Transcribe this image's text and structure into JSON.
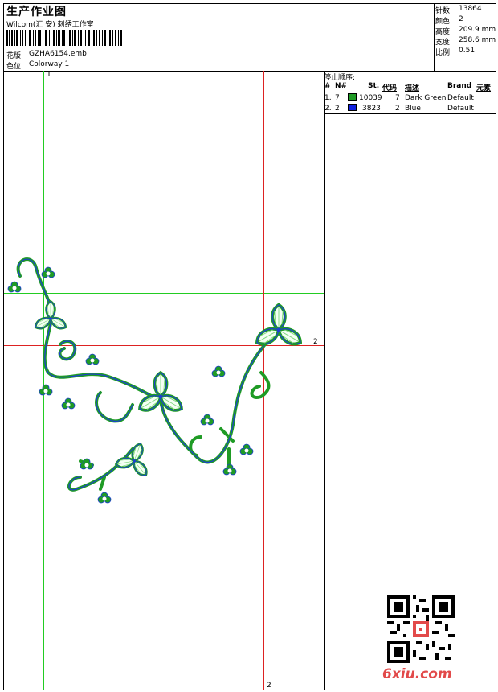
{
  "header": {
    "title": "生产作业图",
    "subtitle": "Wilcom(汇 安) 刺绣工作室",
    "design_label": "花版:",
    "design_value": "GZHA6154.emb",
    "colorway_label": "色位:",
    "colorway_value": "Colorway 1"
  },
  "stats": [
    {
      "label": "针数:",
      "value": "13864"
    },
    {
      "label": "颜色:",
      "value": "2"
    },
    {
      "label": "高度:",
      "value": "209.9 mm"
    },
    {
      "label": "宽度:",
      "value": "258.6 mm"
    },
    {
      "label": "比例:",
      "value": "0.51"
    }
  ],
  "stop_sequence": {
    "title": "停止顺序:",
    "headers": [
      "#",
      "N#",
      "St.",
      "代码",
      "描述",
      "Brand",
      "元素"
    ],
    "rows": [
      {
        "index": "1.",
        "needle": "7",
        "stitches": "10039",
        "code": "7",
        "description": "Dark Green",
        "brand": "Default",
        "color": "#1f9b25"
      },
      {
        "index": "2.",
        "needle": "2",
        "stitches": "3823",
        "code": "2",
        "description": "Blue",
        "brand": "Default",
        "color": "#1020e0"
      }
    ]
  },
  "guides": {
    "green_top": "1",
    "red_right": "2",
    "red_bottom": "2"
  },
  "watermark": "6xiu.com",
  "colors": {
    "thread_green": "#1f9b25",
    "thread_blue": "#1d3fd0",
    "guide_green": "#22cc22",
    "guide_red": "#dd2222"
  }
}
